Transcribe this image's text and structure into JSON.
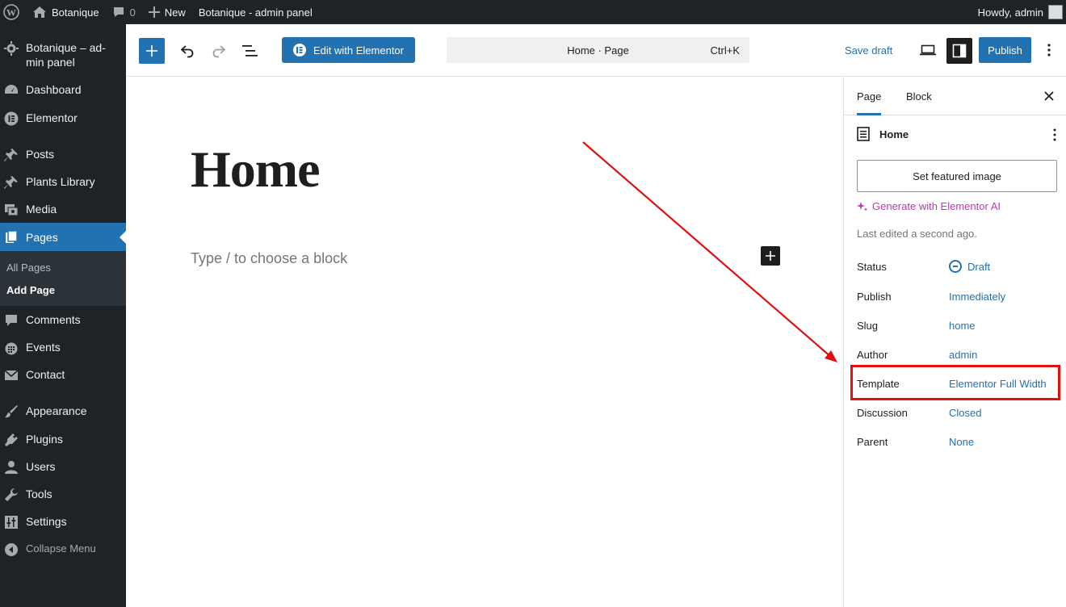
{
  "admin_bar": {
    "site_name": "Botanique",
    "comments_count": "0",
    "new_label": "New",
    "site_link": "Botanique - admin panel",
    "howdy": "Howdy, admin"
  },
  "sidebar": {
    "site_item": "Botanique – ad-min panel",
    "items": [
      {
        "label": "Dashboard",
        "icon": "dashboard-icon"
      },
      {
        "label": "Elementor",
        "icon": "elementor-icon"
      },
      {
        "label": "Posts",
        "icon": "pin-icon"
      },
      {
        "label": "Plants Library",
        "icon": "pin-icon"
      },
      {
        "label": "Media",
        "icon": "media-icon"
      },
      {
        "label": "Pages",
        "icon": "pages-icon"
      },
      {
        "label": "Comments",
        "icon": "comment-icon"
      },
      {
        "label": "Events",
        "icon": "calendar-icon"
      },
      {
        "label": "Contact",
        "icon": "mail-icon"
      },
      {
        "label": "Appearance",
        "icon": "brush-icon"
      },
      {
        "label": "Plugins",
        "icon": "plugin-icon"
      },
      {
        "label": "Users",
        "icon": "user-icon"
      },
      {
        "label": "Tools",
        "icon": "wrench-icon"
      },
      {
        "label": "Settings",
        "icon": "settings-icon"
      }
    ],
    "submenu": {
      "all_pages": "All Pages",
      "add_page": "Add Page"
    },
    "collapse": "Collapse Menu"
  },
  "header": {
    "edit_elementor": "Edit with Elementor",
    "command": "Home · Page",
    "shortcut": "Ctrl+K",
    "save_draft": "Save draft",
    "publish": "Publish"
  },
  "canvas": {
    "title": "Home",
    "placeholder": "Type / to choose a block"
  },
  "panel": {
    "tabs": [
      "Page",
      "Block"
    ],
    "doc_title": "Home",
    "featured_image": "Set featured image",
    "ai_link": "Generate with Elementor AI",
    "last_edited": "Last edited a second ago.",
    "rows": [
      {
        "label": "Status",
        "value": "Draft"
      },
      {
        "label": "Publish",
        "value": "Immediately"
      },
      {
        "label": "Slug",
        "value": "home"
      },
      {
        "label": "Author",
        "value": "admin"
      },
      {
        "label": "Template",
        "value": "Elementor Full Width"
      },
      {
        "label": "Discussion",
        "value": "Closed"
      },
      {
        "label": "Parent",
        "value": "None"
      }
    ]
  },
  "colors": {
    "admin_dark": "#1d2327",
    "accent": "#2271b1",
    "ai_magenta": "#c036b8",
    "annotation_red": "#e01010"
  }
}
